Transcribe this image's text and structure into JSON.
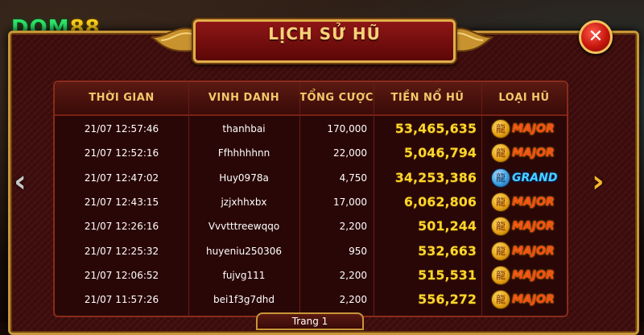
{
  "brand": {
    "logo_letters": "DOM",
    "logo_number": "88"
  },
  "dialog": {
    "title": "LỊCH SỬ HŨ",
    "close_label": "✕",
    "pagination_label": "Trang 1"
  },
  "table": {
    "headers": [
      "THỜI GIAN",
      "VINH DANH",
      "TỔNG CƯỢC",
      "TIỀN NỔ HŨ",
      "LOẠI HŨ"
    ],
    "rows": [
      {
        "time": "21/07 12:57:46",
        "user": "thanhbai",
        "bet": "170,000",
        "jackpot": "53,465,635",
        "type": "MAJOR"
      },
      {
        "time": "21/07 12:52:16",
        "user": "Ffhhhhhnn",
        "bet": "22,000",
        "jackpot": "5,046,794",
        "type": "MAJOR"
      },
      {
        "time": "21/07 12:47:02",
        "user": "Huy0978a",
        "bet": "4,750",
        "jackpot": "34,253,386",
        "type": "GRAND"
      },
      {
        "time": "21/07 12:43:15",
        "user": "jzjxhhxbx",
        "bet": "17,000",
        "jackpot": "6,062,806",
        "type": "MAJOR"
      },
      {
        "time": "21/07 12:26:16",
        "user": "Vvvtttreewqqo",
        "bet": "2,200",
        "jackpot": "501,244",
        "type": "MAJOR"
      },
      {
        "time": "21/07 12:25:32",
        "user": "huyeniu250306",
        "bet": "950",
        "jackpot": "532,663",
        "type": "MAJOR"
      },
      {
        "time": "21/07 12:06:52",
        "user": "fujvg111",
        "bet": "2,200",
        "jackpot": "515,531",
        "type": "MAJOR"
      },
      {
        "time": "21/07 11:57:26",
        "user": "bei1f3g7dhd",
        "bet": "2,200",
        "jackpot": "556,272",
        "type": "MAJOR"
      }
    ]
  },
  "nav": {
    "prev_icon": "‹",
    "next_icon": "›"
  },
  "colors": {
    "accent_gold": "#f2c86a",
    "jackpot_yellow": "#ffd62a",
    "major_red": "#ff4a1a",
    "grand_blue": "#4ad0ff"
  }
}
